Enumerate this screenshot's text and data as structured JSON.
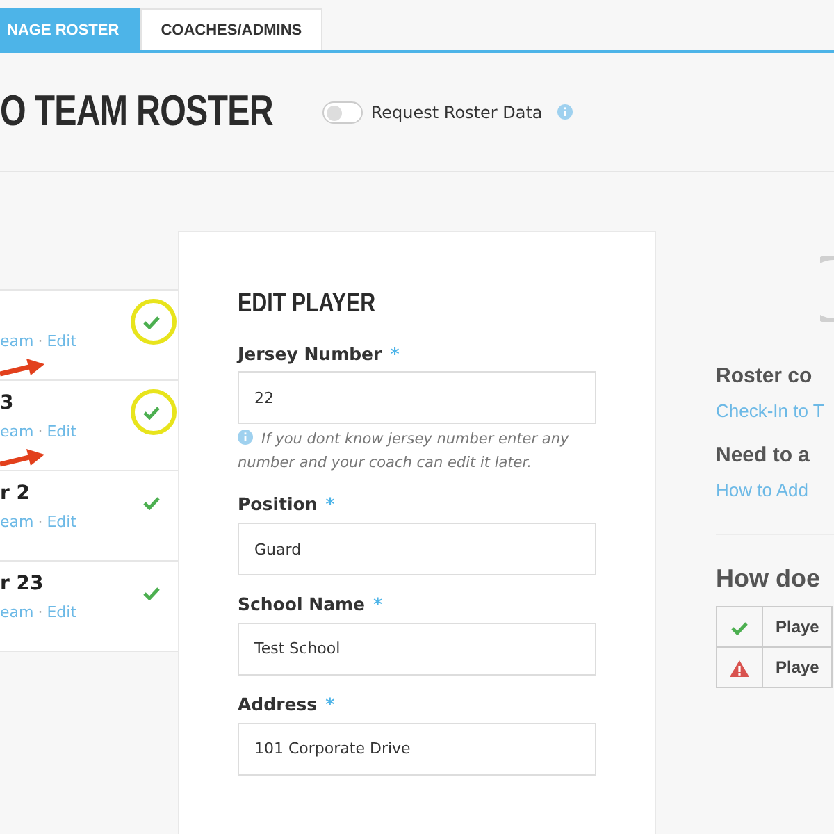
{
  "tabs": [
    {
      "label": "NAGE ROSTER",
      "selected": true
    },
    {
      "label": "COACHES/ADMINS",
      "selected": false
    }
  ],
  "header": {
    "title": "O TEAM ROSTER",
    "toggle": {
      "label": "Request Roster Data",
      "on": false
    }
  },
  "players": [
    {
      "team_link": "eam",
      "separator": "·",
      "edit_link": "Edit",
      "complete": true,
      "annotated": true
    },
    {
      "name": "3",
      "team_link": "eam",
      "separator": "·",
      "edit_link": "Edit",
      "complete": true,
      "annotated": true
    },
    {
      "name": "r 2",
      "team_link": "eam",
      "separator": "·",
      "edit_link": "Edit",
      "complete": true,
      "annotated": false
    },
    {
      "name": "r 23",
      "team_link": "eam",
      "separator": "·",
      "edit_link": "Edit",
      "complete": true,
      "annotated": false
    }
  ],
  "edit_player": {
    "title": "EDIT PLAYER",
    "fields": [
      {
        "label": "Jersey Number",
        "required_mark": "*",
        "value": "22",
        "hint": "If you dont know jersey number enter any number and your coach can edit it later."
      },
      {
        "label": "Position",
        "required_mark": "*",
        "value": "Guard"
      },
      {
        "label": "School Name",
        "required_mark": "*",
        "value": "Test School"
      },
      {
        "label": "Address",
        "required_mark": "*",
        "value": "101 Corporate Drive"
      }
    ]
  },
  "help": [
    {
      "heading": "Roster co",
      "link": "Check-In to T"
    },
    {
      "heading": "Need to a",
      "link": "How to Add"
    }
  ],
  "faq_title": "How doe",
  "legend": [
    {
      "kind": "complete",
      "text": "Playe"
    },
    {
      "kind": "warning",
      "text": "Playe"
    }
  ]
}
